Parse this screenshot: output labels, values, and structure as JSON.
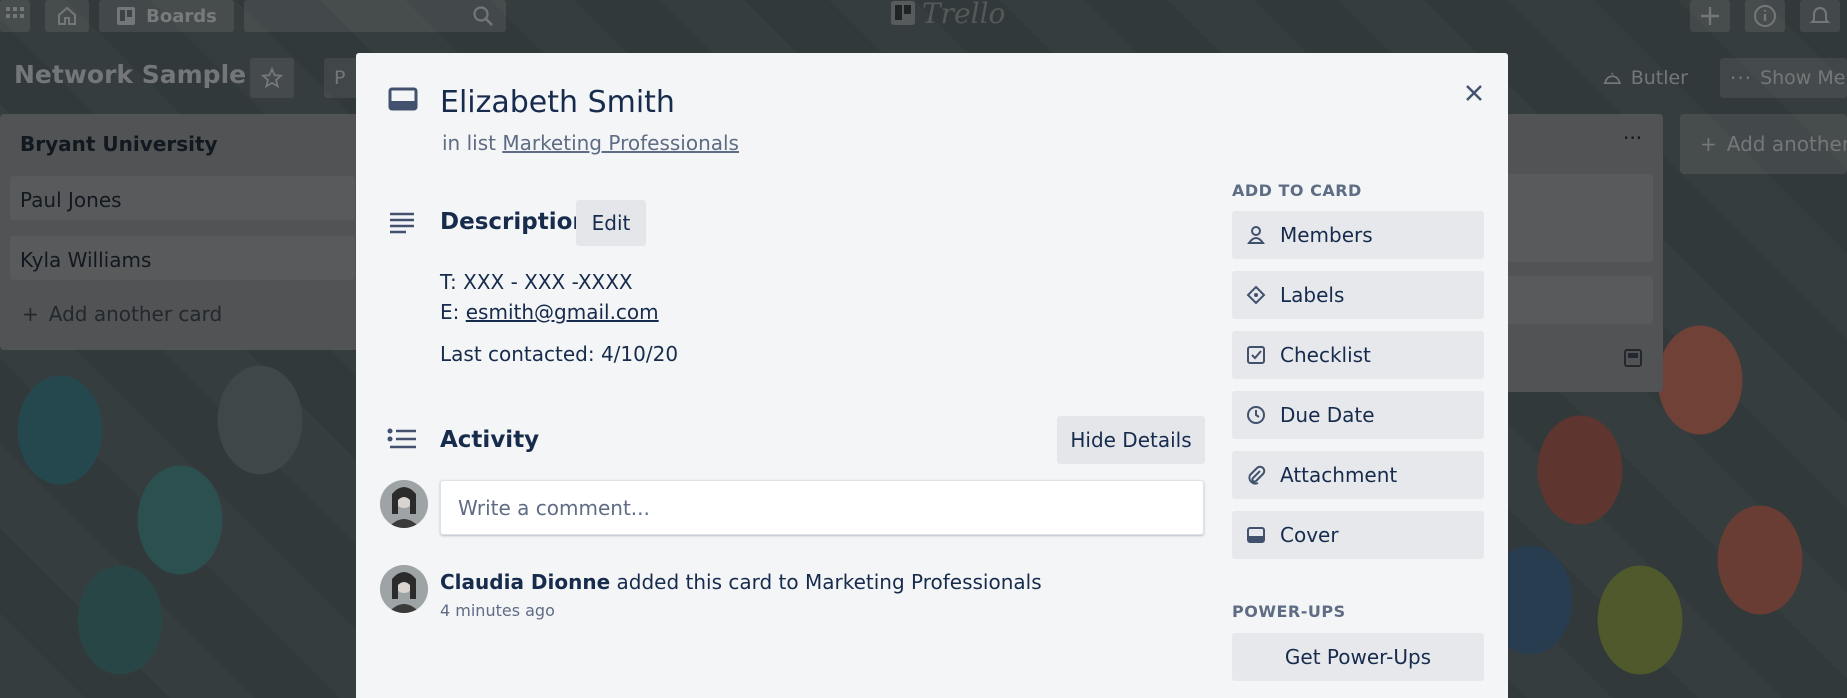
{
  "topbar": {
    "boards_label": "Boards",
    "logo_text": "Trello"
  },
  "board": {
    "title": "Network Sample",
    "partial_button": "P",
    "butler_label": "Butler",
    "show_menu_label": "Show Me",
    "add_another_list": "Add another"
  },
  "list": {
    "title": "Bryant University",
    "cards": [
      "Paul Jones",
      "Kyla Williams"
    ],
    "add_card": "Add another card"
  },
  "card": {
    "title": "Elizabeth Smith",
    "in_list_prefix": "in list",
    "list_name": "Marketing Professionals",
    "description_heading": "Description",
    "edit_label": "Edit",
    "desc_phone": "T: XXX - XXX -XXXX",
    "desc_email_prefix": "E:",
    "desc_email": "esmith@gmail.com",
    "desc_last_contacted": "Last contacted: 4/10/20",
    "activity_heading": "Activity",
    "hide_details_label": "Hide Details",
    "comment_placeholder": "Write a comment...",
    "activity_user": "Claudia Dionne",
    "activity_action": "added this card to Marketing Professionals",
    "activity_time": "4 minutes ago"
  },
  "sidebar": {
    "add_to_card_heading": "ADD TO CARD",
    "buttons": [
      {
        "label": "Members",
        "icon": "person-icon"
      },
      {
        "label": "Labels",
        "icon": "tag-icon"
      },
      {
        "label": "Checklist",
        "icon": "checkbox-icon"
      },
      {
        "label": "Due Date",
        "icon": "clock-icon"
      },
      {
        "label": "Attachment",
        "icon": "paperclip-icon"
      },
      {
        "label": "Cover",
        "icon": "cover-icon"
      }
    ],
    "power_ups_heading": "POWER-UPS",
    "get_power_ups_label": "Get Power-Ups"
  }
}
